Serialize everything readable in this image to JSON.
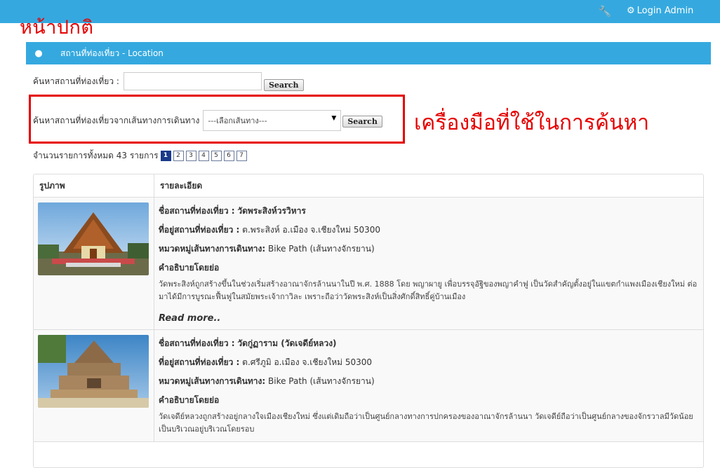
{
  "topbar": {
    "wrench_icon": "wrench-icon",
    "login_label": "Login Admin",
    "gear_icon": "gear-icon"
  },
  "page_label": "หน้าปกติ",
  "panel": {
    "title": "สถานที่ท่องเที่ยว - Location",
    "icon": "map-marker-icon"
  },
  "search": {
    "label": "ค้นหาสถานที่ท่องเที่ยว :",
    "value": "",
    "button": "Search"
  },
  "route_search": {
    "label": "ค้นหาสถานที่ท่องเที่ยวจากเส้นทางการเดินทาง",
    "selected": "---เลือกเส้นทาง---",
    "button": "Search"
  },
  "annotation": "เครื่องมือที่ใช้ในการค้นหา",
  "count_text": "จำนวนรายการทั้งหมด 43 รายการ",
  "pages": [
    "1",
    "2",
    "3",
    "4",
    "5",
    "6",
    "7"
  ],
  "table": {
    "headers": [
      "รูปภาพ",
      "รายละเอียด"
    ],
    "rows": [
      {
        "name_label": "ชื่อสถานที่ท่องเที่ยว :",
        "name": "วัดพระสิงห์วรวิหาร",
        "addr_label": "ที่อยู่สถานที่ท่องเที่ยว :",
        "addr": "ต.พระสิงห์ อ.เมือง จ.เชียงใหม่ 50300",
        "route_label": "หมวดหมู่เส้นทางการเดินทาง:",
        "route": "Bike Path (เส้นทางจักรยาน)",
        "desc_label": "คำอธิบายโดยย่อ",
        "desc": "วัดพระสิงห์ถูกสร้างขึ้นในช่วงเริ่มสร้างอาณาจักรล้านนาในปี พ.ศ. 1888 โดย พญาผายู เพื่อบรรจุอัฐิของพญาคำฟู เป็นวัดสำคัญตั้งอยู่ในแขตกำแพงเมืองเชียงใหม่ ต่อมาได้มีการบูรณะฟื้นฟูในสมัยพระเจ้ากาวิละ เพราะถือว่าวัดพระสิงห์เป็นสิ่งศักดิ์สิทธิ์คู่บ้านเมือง",
        "read_more": "Read more.."
      },
      {
        "name_label": "ชื่อสถานที่ท่องเที่ยว :",
        "name": "วัดกู่ฏาราม (วัดเจดีย์หลวง)",
        "addr_label": "ที่อยู่สถานที่ท่องเที่ยว :",
        "addr": "ต.ศรีภูมิ อ.เมือง จ.เชียงใหม่ 50300",
        "route_label": "หมวดหมู่เส้นทางการเดินทาง:",
        "route": "Bike Path (เส้นทางจักรยาน)",
        "desc_label": "คำอธิบายโดยย่อ",
        "desc": "วัดเจดีย์หลวงถูกสร้างอยู่กลางใจเมืองเชียงใหม่ ซึ่งแต่เดิมถือว่าเป็นศูนย์กลางทางการปกครองของอาณาจักรล้านนา วัดเจดีย์ถือว่าเป็นศูนย์กลางของจักรวาลมีวัดน้อยเป็นบริเวณอยู่บริเวณโดยรอบ"
      }
    ]
  }
}
